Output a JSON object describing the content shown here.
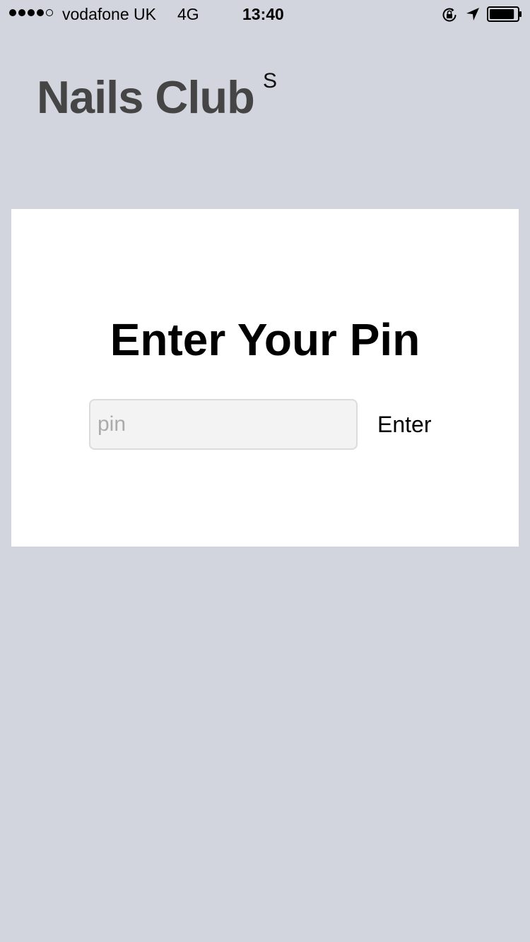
{
  "status_bar": {
    "carrier": "vodafone UK",
    "network": "4G",
    "time": "13:40",
    "signal_bars_filled": 4,
    "signal_bars_total": 5,
    "battery_level": 0.9,
    "icons": [
      "orientation-lock-icon",
      "location-arrow-icon",
      "battery-icon"
    ]
  },
  "header": {
    "title": "Nails Club",
    "superscript": "S"
  },
  "pin_form": {
    "heading": "Enter Your Pin",
    "input_placeholder": "pin",
    "input_value": "",
    "submit_label": "Enter"
  }
}
